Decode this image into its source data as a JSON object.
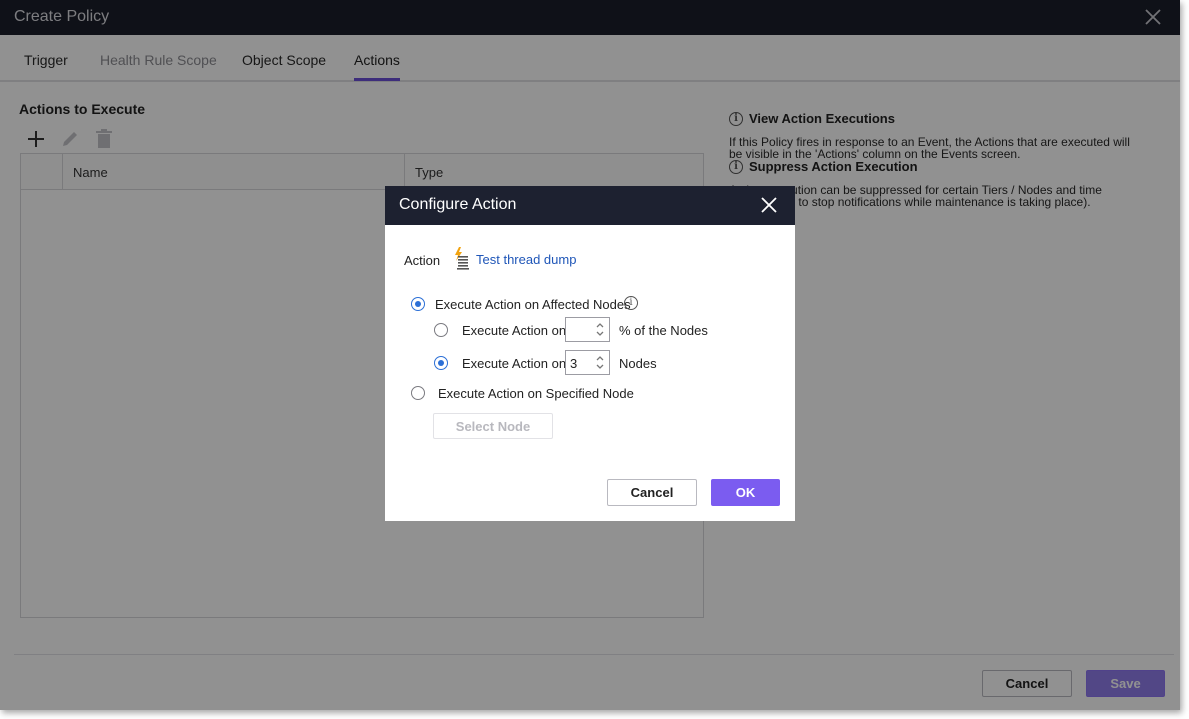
{
  "window": {
    "title": "Create Policy"
  },
  "tabs": [
    {
      "label": "Trigger",
      "state": "normal"
    },
    {
      "label": "Health Rule Scope",
      "state": "disabled"
    },
    {
      "label": "Object Scope",
      "state": "normal"
    },
    {
      "label": "Actions",
      "state": "active"
    }
  ],
  "actions_section": {
    "title": "Actions to Execute",
    "toolbar": {
      "add_icon": "plus-icon",
      "edit_icon": "pencil-icon",
      "delete_icon": "trash-icon"
    },
    "table": {
      "columns": [
        "Name",
        "Type"
      ],
      "rows": []
    }
  },
  "info": {
    "view_title": "View Action Executions",
    "view_line1": "If this Policy fires in response to an Event, the Actions that are executed will",
    "view_line2": "be visible in the 'Actions' column on the Events screen.",
    "suppress_title": "Suppress Action Execution",
    "suppress_line1": "Action execution can be suppressed for certain Tiers / Nodes and time",
    "suppress_line2": "for example, to stop notifications while maintenance is taking place)."
  },
  "footer": {
    "cancel_label": "Cancel",
    "save_label": "Save"
  },
  "modal": {
    "title": "Configure Action",
    "action_label": "Action",
    "action_name": "Test thread dump",
    "action_icon": "thread-dump-icon",
    "affected_nodes_label": "Execute Action on Affected Nodes",
    "percent_option_label": "Execute Action on",
    "percent_value": "",
    "percent_suffix": "% of the Nodes",
    "count_option_label": "Execute Action on",
    "count_value": "3",
    "count_suffix": "Nodes",
    "specified_node_label": "Execute Action on Specified Node",
    "select_node_label": "Select Node",
    "cancel_label": "Cancel",
    "ok_label": "OK",
    "selected_scope": "affected_nodes",
    "selected_mode": "count"
  },
  "colors": {
    "accent": "#7b5cf0",
    "title_bar": "#1b1f2b",
    "radio_checked": "#2b6fd6",
    "link": "#1f56b8"
  }
}
